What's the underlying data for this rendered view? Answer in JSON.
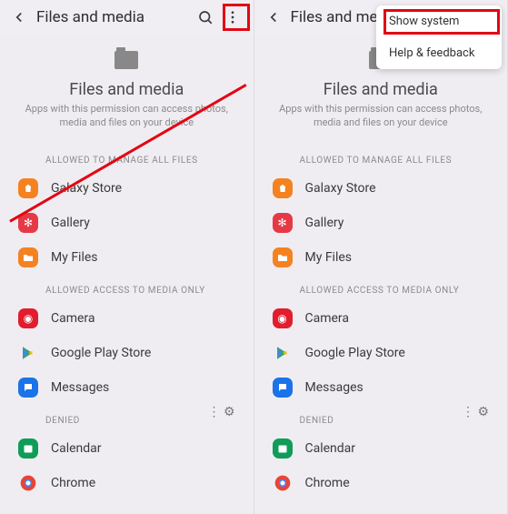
{
  "screen": {
    "topbar_title": "Files and media",
    "page_title": "Files and media",
    "page_sub": "Apps with this permission can access photos, media and files on your device",
    "section_manage": "ALLOWED TO MANAGE ALL FILES",
    "section_media": "ALLOWED ACCESS TO MEDIA ONLY",
    "section_denied": "DENIED",
    "apps_manage": [
      {
        "label": "Galaxy Store"
      },
      {
        "label": "Gallery"
      },
      {
        "label": "My Files"
      }
    ],
    "apps_media": [
      {
        "label": "Camera"
      },
      {
        "label": "Google Play Store"
      },
      {
        "label": "Messages"
      }
    ],
    "apps_denied": [
      {
        "label": "Calendar"
      },
      {
        "label": "Chrome"
      }
    ]
  },
  "menu": {
    "show_system": "Show system",
    "help": "Help & feedback"
  }
}
